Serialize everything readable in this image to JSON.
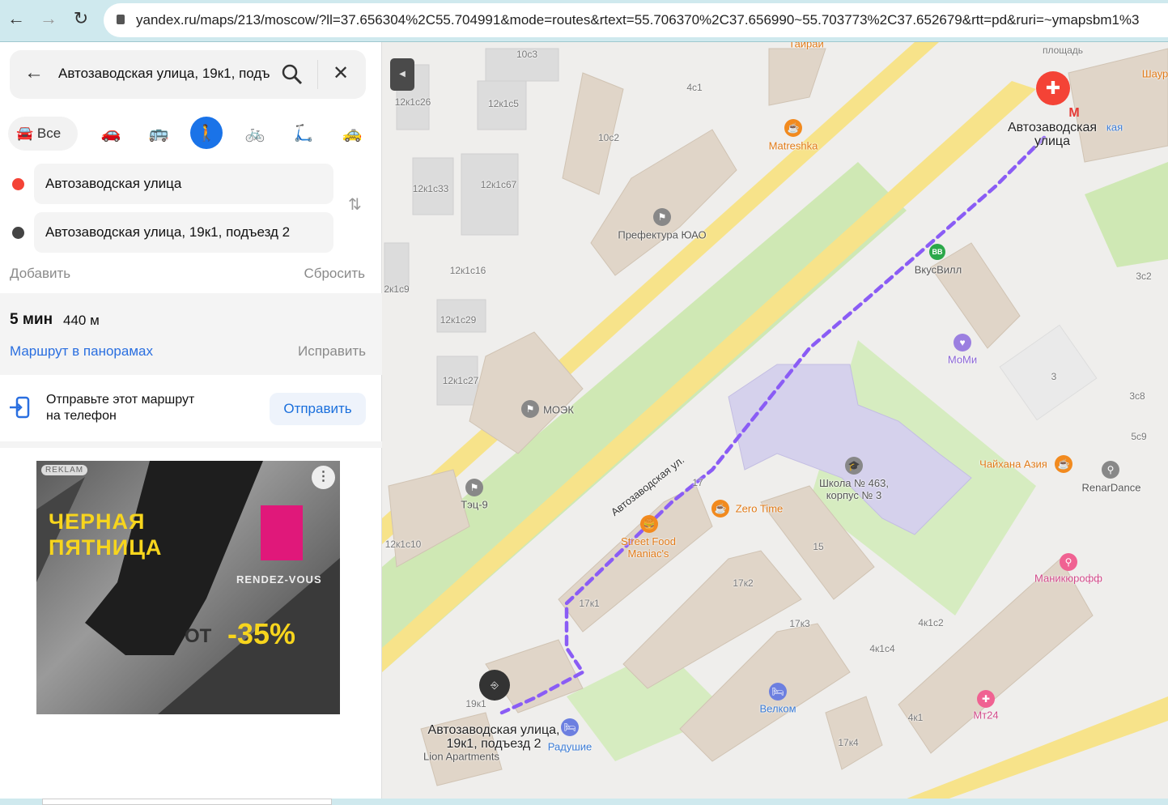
{
  "browser": {
    "url": "yandex.ru/maps/213/moscow/?ll=37.656304%2C55.704991&mode=routes&rtext=55.706370%2C37.656990~55.703773%2C37.652679&rtt=pd&ruri=~ymapsbm1%3"
  },
  "panel": {
    "search_value": "Автозаводская улица, 19к1, подъезд 2",
    "modes": {
      "all": "Все",
      "active": "pedestrian"
    },
    "from": "Автозаводская улица",
    "to": "Автозаводская улица, 19к1, подъезд 2",
    "add": "Добавить",
    "reset": "Сбросить",
    "duration": "5 мин",
    "distance": "440 м",
    "panorama_link": "Маршрут в панорамах",
    "fix": "Исправить",
    "send_text_1": "Отправьте этот маршрут",
    "send_text_2": "на телефон",
    "send_button": "Отправить",
    "ad": {
      "badge": "REKLAM",
      "headline_1": "ЧЕРНАЯ",
      "headline_2": "ПЯТНИЦА",
      "brand": "RENDEZ-VOUS",
      "from": "ОТ",
      "discount": "-35%"
    }
  },
  "colors": {
    "accent": "#1a73e8",
    "route": "#8a5cf5",
    "road": "#f7e38a",
    "start": "#f44336"
  },
  "map": {
    "labels": [
      "10с3",
      "4с1",
      "12к1с26",
      "12к1с5",
      "10с2",
      "Matreshka",
      "12к1с33",
      "12к1с67",
      "Префектура ЮАО",
      "12к1с16",
      "2к1с9",
      "12к1с29",
      "12к1с27",
      "МОЭК",
      "Тэц-9",
      "12к1с10",
      "Автозаводская ул.",
      "17",
      "Zero Time",
      "Street Food Maniac's",
      "Школа № 463, корпус № 3",
      "15",
      "17к2",
      "17к1",
      "17к3",
      "4к1с2",
      "4к1с4",
      "Велком",
      "17к4",
      "4к1",
      "Мт24",
      "Маникюрофф",
      "Чайхана Азия",
      "RenarDance",
      "3с8",
      "5с9",
      "3",
      "3с2",
      "МоМи",
      "ВкусВилл",
      "Автозаводская улица",
      "площадь",
      "Шаур",
      "Автозаводская улица, 19к1, подъезд 2",
      "19к1",
      "Lion Apartments",
      "Радушие",
      "Таирай",
      "кая"
    ]
  }
}
